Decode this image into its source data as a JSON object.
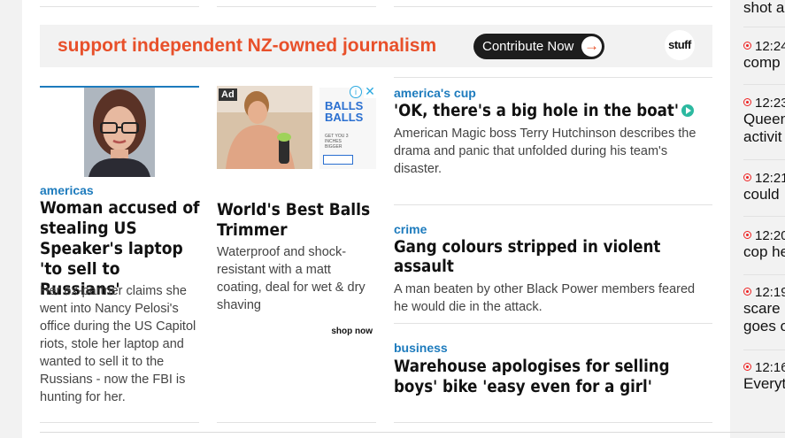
{
  "banner": {
    "tagline": "support independent NZ-owned journalism",
    "contribute_label": "Contribute Now",
    "logo_text": "stuff"
  },
  "story_main": {
    "tag": "americas",
    "headline": "Woman accused of stealing US Speaker's laptop 'to sell to Russians'",
    "summary": "Her ex-partner claims she went into Nancy Pelosi's office during the US Capitol riots, stole her laptop and wanted to sell it to the Russians - now the FBI is hunting for her."
  },
  "ad": {
    "label": "Ad",
    "pack_title": "BALLS BALLS",
    "pack_small": "GET YOU 3 INCHES BIGGER",
    "headline": "World's Best Balls Trimmer",
    "summary": "Waterproof and shock-resistant with a matt coating, deal for wet & dry shaving",
    "cta": "shop now",
    "info_icon": "i",
    "close_icon": "✕"
  },
  "stories_right": [
    {
      "tag": "america's cup",
      "headline": "'OK, there's a big hole in the boat'",
      "summary": "American Magic boss Terry Hutchinson describes the drama and panic that unfolded during his team's disaster."
    },
    {
      "tag": "crime",
      "headline": "Gang colours stripped in violent assault",
      "summary": "A man beaten by other Black Power members feared he would die in the attack."
    },
    {
      "tag": "business",
      "headline": "Warehouse apologises for selling boys' bike 'easy even for a girl'",
      "summary": ""
    }
  ],
  "sidebar": {
    "top_fragment": "shot a",
    "items": [
      {
        "time": "12:24",
        "text": "comp"
      },
      {
        "time": "12:23",
        "text": "Queen",
        "text2": "activit"
      },
      {
        "time": "12:21",
        "text": "could"
      },
      {
        "time": "12:20",
        "text": "cop he"
      },
      {
        "time": "12:19",
        "text": "scare",
        "text2": "goes o"
      },
      {
        "time": "12:16",
        "text": "Everyt"
      }
    ]
  },
  "colors": {
    "accent": "#1d7bbd",
    "banner_text": "#e8502a",
    "live_dot": "#e22222",
    "video_icon": "#2cb9a0"
  }
}
